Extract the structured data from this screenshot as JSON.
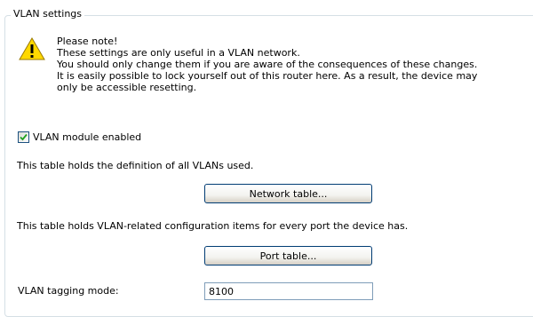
{
  "group": {
    "title": "VLAN settings"
  },
  "note": {
    "icon": "warning-icon",
    "lines": [
      "Please note!",
      "These settings are only useful in a VLAN network.",
      "You should only change them if you are aware of the consequences of these changes.",
      "It is easily possible to lock yourself out of this router here. As a result, the device may",
      "only be accessible resetting."
    ]
  },
  "vlan_module": {
    "label": "VLAN module enabled",
    "checked": true
  },
  "network": {
    "description": "This table holds the definition of all VLANs used.",
    "button_label": "Network table..."
  },
  "port": {
    "description": "This table holds VLAN-related configuration items for every port the device has.",
    "button_label": "Port table..."
  },
  "tagging": {
    "label": "VLAN tagging mode:",
    "value": "8100"
  },
  "colors": {
    "group_border": "#d5dfe5",
    "button_border": "#003c74",
    "input_border": "#7f9db9",
    "checkbox_border": "#1c5180",
    "check_mark": "#21a121",
    "warning_yellow": "#ffd800"
  }
}
